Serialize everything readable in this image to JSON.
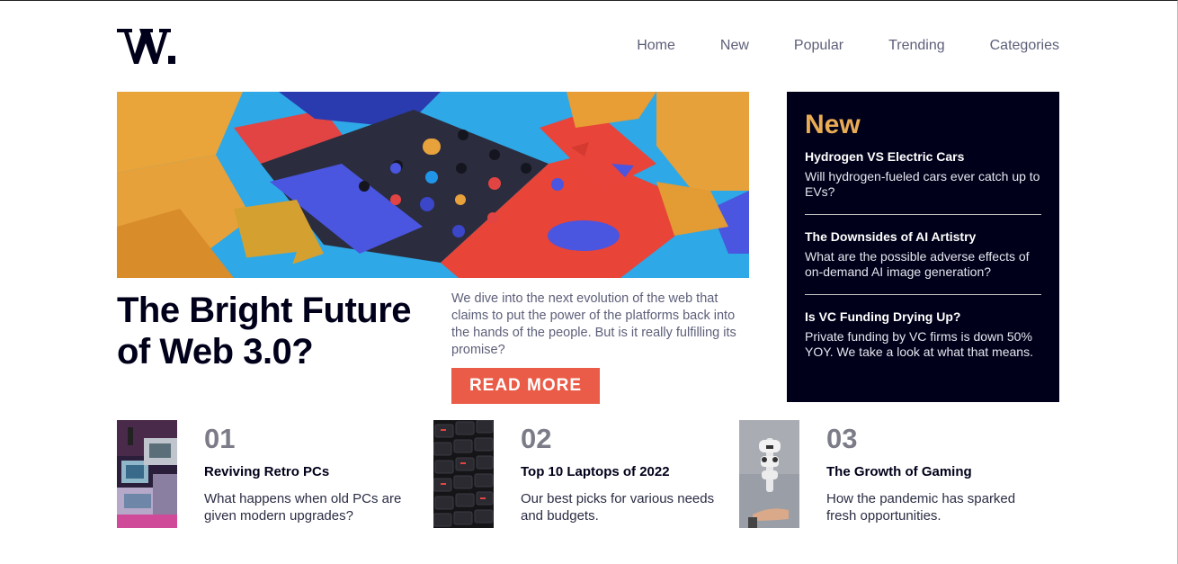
{
  "logo": {
    "text": "W."
  },
  "nav": {
    "items": [
      {
        "label": "Home"
      },
      {
        "label": "New"
      },
      {
        "label": "Popular"
      },
      {
        "label": "Trending"
      },
      {
        "label": "Categories"
      }
    ]
  },
  "hero": {
    "title": "The Bright Future of Web 3.0?",
    "description": "We dive into the next evolution of the web that claims to put the power of the platforms back into the hands of the people. But is it really fulfilling its promise?",
    "button_label": "READ MORE"
  },
  "new_panel": {
    "heading": "New",
    "items": [
      {
        "title": "Hydrogen VS Electric Cars",
        "desc": "Will hydrogen-fueled cars ever catch up to EVs?"
      },
      {
        "title": "The Downsides of AI Artistry",
        "desc": "What are the possible adverse effects of on-demand AI image generation?"
      },
      {
        "title": "Is VC Funding Drying Up?",
        "desc": "Private funding by VC firms is down 50% YOY. We take a look at what that means."
      }
    ]
  },
  "cards": [
    {
      "num": "01",
      "title": "Reviving Retro PCs",
      "desc": "What happens when old PCs are given modern upgrades?"
    },
    {
      "num": "02",
      "title": "Top 10 Laptops of 2022",
      "desc": "Our best picks for various needs and budgets."
    },
    {
      "num": "03",
      "title": "The Growth of Gaming",
      "desc": "How the pandemic has sparked fresh opportunities."
    }
  ],
  "colors": {
    "dark": "#00001a",
    "accent": "#ea5c47",
    "gold": "#e9ab53",
    "grey": "#5d5f79"
  }
}
